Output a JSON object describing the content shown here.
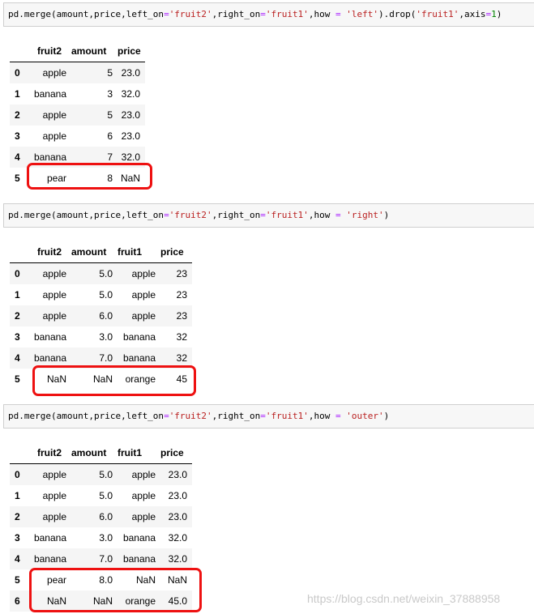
{
  "cells": [
    {
      "code": [
        {
          "t": "pd.merge(amount,price,left_on",
          "c": "plain"
        },
        {
          "t": "=",
          "c": "op"
        },
        {
          "t": "'fruit2'",
          "c": "str"
        },
        {
          "t": ",right_on",
          "c": "plain"
        },
        {
          "t": "=",
          "c": "op"
        },
        {
          "t": "'fruit1'",
          "c": "str"
        },
        {
          "t": ",how ",
          "c": "plain"
        },
        {
          "t": "=",
          "c": "op"
        },
        {
          "t": " ",
          "c": "plain"
        },
        {
          "t": "'left'",
          "c": "str"
        },
        {
          "t": ").drop(",
          "c": "plain"
        },
        {
          "t": "'fruit1'",
          "c": "str"
        },
        {
          "t": ",axis",
          "c": "plain"
        },
        {
          "t": "=",
          "c": "op"
        },
        {
          "t": "1",
          "c": "num"
        },
        {
          "t": ")",
          "c": "plain"
        }
      ],
      "table": {
        "columns": [
          "fruit2",
          "amount",
          "price"
        ],
        "rows": [
          [
            "0",
            "apple",
            "5",
            "23.0"
          ],
          [
            "1",
            "banana",
            "3",
            "32.0"
          ],
          [
            "2",
            "apple",
            "5",
            "23.0"
          ],
          [
            "3",
            "apple",
            "6",
            "23.0"
          ],
          [
            "4",
            "banana",
            "7",
            "32.0"
          ],
          [
            "5",
            "pear",
            "8",
            "NaN"
          ]
        ]
      }
    },
    {
      "code": [
        {
          "t": "pd.merge(amount,price,left_on",
          "c": "plain"
        },
        {
          "t": "=",
          "c": "op"
        },
        {
          "t": "'fruit2'",
          "c": "str"
        },
        {
          "t": ",right_on",
          "c": "plain"
        },
        {
          "t": "=",
          "c": "op"
        },
        {
          "t": "'fruit1'",
          "c": "str"
        },
        {
          "t": ",how ",
          "c": "plain"
        },
        {
          "t": "=",
          "c": "op"
        },
        {
          "t": " ",
          "c": "plain"
        },
        {
          "t": "'right'",
          "c": "str"
        },
        {
          "t": ")",
          "c": "plain"
        }
      ],
      "table": {
        "columns": [
          "fruit2",
          "amount",
          "fruit1",
          "price"
        ],
        "rows": [
          [
            "0",
            "apple",
            "5.0",
            "apple",
            "23"
          ],
          [
            "1",
            "apple",
            "5.0",
            "apple",
            "23"
          ],
          [
            "2",
            "apple",
            "6.0",
            "apple",
            "23"
          ],
          [
            "3",
            "banana",
            "3.0",
            "banana",
            "32"
          ],
          [
            "4",
            "banana",
            "7.0",
            "banana",
            "32"
          ],
          [
            "5",
            "NaN",
            "NaN",
            "orange",
            "45"
          ]
        ]
      }
    },
    {
      "code": [
        {
          "t": "pd.merge(amount,price,left_on",
          "c": "plain"
        },
        {
          "t": "=",
          "c": "op"
        },
        {
          "t": "'fruit2'",
          "c": "str"
        },
        {
          "t": ",right_on",
          "c": "plain"
        },
        {
          "t": "=",
          "c": "op"
        },
        {
          "t": "'fruit1'",
          "c": "str"
        },
        {
          "t": ",how ",
          "c": "plain"
        },
        {
          "t": "=",
          "c": "op"
        },
        {
          "t": " ",
          "c": "plain"
        },
        {
          "t": "'outer'",
          "c": "str"
        },
        {
          "t": ")",
          "c": "plain"
        }
      ],
      "table": {
        "columns": [
          "fruit2",
          "amount",
          "fruit1",
          "price"
        ],
        "rows": [
          [
            "0",
            "apple",
            "5.0",
            "apple",
            "23.0"
          ],
          [
            "1",
            "apple",
            "5.0",
            "apple",
            "23.0"
          ],
          [
            "2",
            "apple",
            "6.0",
            "apple",
            "23.0"
          ],
          [
            "3",
            "banana",
            "3.0",
            "banana",
            "32.0"
          ],
          [
            "4",
            "banana",
            "7.0",
            "banana",
            "32.0"
          ],
          [
            "5",
            "pear",
            "8.0",
            "NaN",
            "NaN"
          ],
          [
            "6",
            "NaN",
            "NaN",
            "orange",
            "45.0"
          ]
        ]
      }
    }
  ],
  "watermark": "https://blog.csdn.net/weixin_37888958",
  "colors": {
    "string": "#ba2121",
    "operator": "#aa22ff",
    "number": "#008000",
    "highlight": "#ee1111"
  }
}
